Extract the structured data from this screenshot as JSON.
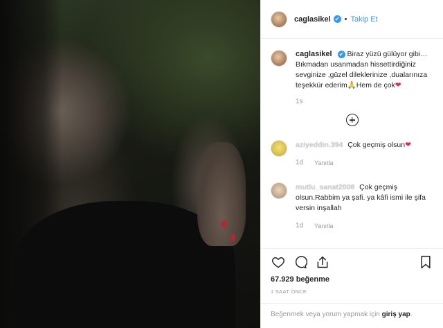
{
  "header": {
    "username": "caglasikel",
    "verified_glyph": "✔",
    "separator": "•",
    "follow_label": "Takip Et"
  },
  "caption": {
    "username": "caglasikel",
    "text": "Biraz yüzü gülüyor gibi… Bıkmadan usanmadan hissettirdiğiniz sevginize ,güzel dileklerinize ,dualarınıza teşekkür ederim🙏Hem de çok",
    "heart": "❤",
    "time": "1s"
  },
  "comments": [
    {
      "username": "aziyeddin.394",
      "text": "Çok geçmiş olsun",
      "heart": "❤",
      "time": "1d",
      "reply_label": "Yanıtla"
    },
    {
      "username": "mutlu_sanat2008",
      "text": "Çok geçmiş olsun.Rabbim ya şafi. ya kâfi ismi ile şifa versin inşallah",
      "heart": "",
      "time": "1d",
      "reply_label": "Yanıtla"
    }
  ],
  "actions": {
    "icons": [
      "heart-outline-icon",
      "comment-icon",
      "share-icon",
      "bookmark-icon"
    ],
    "likes": "67.929 beğenme",
    "ago": "1 SAAT ÖNCE"
  },
  "footer": {
    "prompt": "Beğenmek veya yorum yapmak için",
    "login": "giriş yap",
    "period": "."
  },
  "colors": {
    "accent": "#3897f0",
    "heart": "#e0245e",
    "muted": "#999999"
  }
}
